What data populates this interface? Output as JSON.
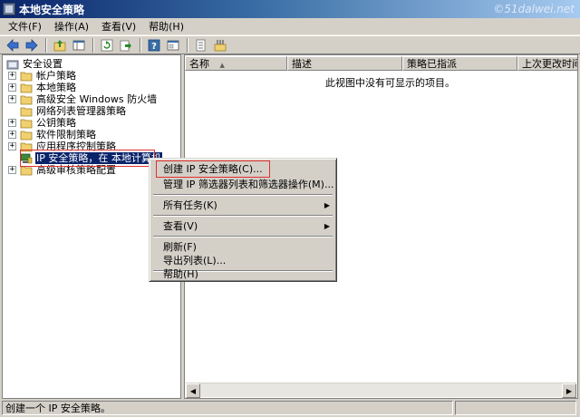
{
  "window": {
    "title": "本地安全策略",
    "watermark": "©51dalwei.net"
  },
  "menubar": [
    {
      "label": "文件(F)"
    },
    {
      "label": "操作(A)"
    },
    {
      "label": "查看(V)"
    },
    {
      "label": "帮助(H)"
    }
  ],
  "toolbar": {
    "buttons": [
      "back-arrow-icon",
      "forward-arrow-icon",
      "up-folder-icon",
      "show-hide-tree-icon",
      "refresh-icon",
      "export-list-icon",
      "help-icon",
      "properties-icon",
      "new-policy-icon",
      "assign-icon"
    ]
  },
  "tree": {
    "root": "安全设置",
    "items": [
      {
        "label": "帐户策略",
        "expander": "+"
      },
      {
        "label": "本地策略",
        "expander": "+"
      },
      {
        "label": "高级安全 Windows 防火墙",
        "expander": "+"
      },
      {
        "label": "网络列表管理器策略",
        "expander": ""
      },
      {
        "label": "公钥策略",
        "expander": "+"
      },
      {
        "label": "软件限制策略",
        "expander": "+"
      },
      {
        "label": "应用程序控制策略",
        "expander": "+"
      },
      {
        "label": "IP 安全策略，在 本地计算机",
        "expander": ""
      },
      {
        "label": "高级审核策略配置",
        "expander": "+"
      }
    ]
  },
  "list": {
    "columns": [
      "名称",
      "描述",
      "策略已指派",
      "上次更改时间"
    ],
    "empty_message": "此视图中没有可显示的项目。"
  },
  "context_menu": {
    "items": [
      {
        "label": "创建 IP 安全策略(C)...",
        "submenu": false
      },
      {
        "label": "管理 IP 筛选器列表和筛选器操作(M)...",
        "submenu": false
      },
      {
        "label": "所有任务(K)",
        "submenu": true
      },
      {
        "label": "查看(V)",
        "submenu": true
      },
      {
        "label": "刷新(F)",
        "submenu": false
      },
      {
        "label": "导出列表(L)...",
        "submenu": false
      },
      {
        "label": "帮助(H)",
        "submenu": false
      }
    ]
  },
  "statusbar": {
    "text": "创建一个 IP 安全策略。"
  },
  "colors": {
    "selection": "#0a246a",
    "highlight_box": "#e03030",
    "folder": "#f0d070"
  }
}
